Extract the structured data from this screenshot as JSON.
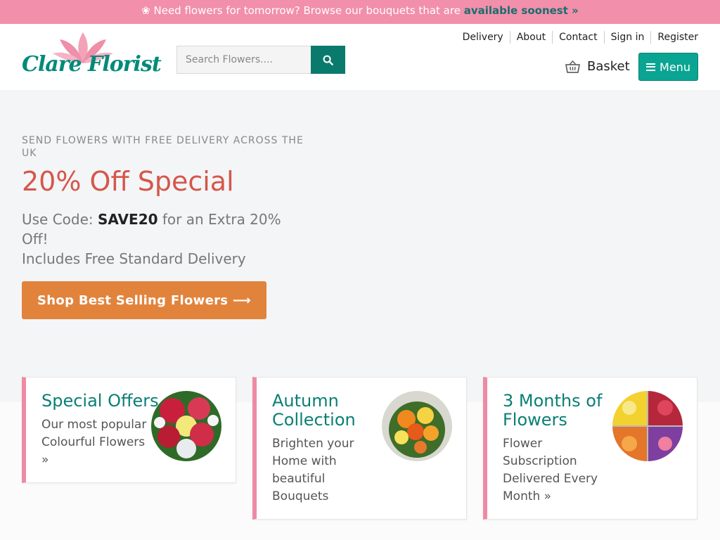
{
  "promo": {
    "text": "❀ Need flowers for tomorrow? Browse our bouquets that are ",
    "link": "available soonest »"
  },
  "header": {
    "logo_text": "Clare Florist",
    "search_placeholder": "Search Flowers....",
    "nav": [
      "Delivery",
      "About",
      "Contact",
      "Sign in",
      "Register"
    ],
    "basket_label": "Basket",
    "menu_label": "Menu"
  },
  "hero": {
    "kicker": "SEND FLOWERS WITH FREE DELIVERY ACROSS THE UK",
    "title": "20% Off Special",
    "code_prefix": "Use Code: ",
    "code": "SAVE20",
    "code_suffix": " for an Extra 20% Off!",
    "delivery_line": "Includes Free Standard Delivery",
    "cta": "Shop Best Selling Flowers ⟶"
  },
  "cards": [
    {
      "title": "Special Offers",
      "desc": "Our most popular Colourful Flowers »"
    },
    {
      "title": "Autumn Collection",
      "desc": "Brighten your Home with beautiful Bouquets"
    },
    {
      "title": "3 Months of Flowers",
      "desc": "Flower Subscription Delivered Every Month »"
    }
  ],
  "colors": {
    "promo_bg": "#f28fab",
    "brand_teal": "#0a7a6c",
    "hero_title": "#d4574a",
    "cta_orange": "#e2833c",
    "card_accent": "#ef8aa4"
  }
}
